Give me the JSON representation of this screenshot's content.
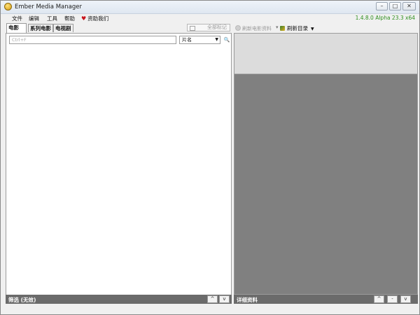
{
  "window": {
    "title": "Ember Media Manager",
    "controls": {
      "minimize": "–",
      "maximize": "□",
      "close": "✕"
    }
  },
  "menu": {
    "items": [
      "文件",
      "编辑",
      "工具",
      "帮助"
    ],
    "donate": {
      "icon": "heart-icon",
      "label": "资助我们"
    },
    "version": "1.4.8.0 Alpha 23.3 x64"
  },
  "tabs": [
    "电影",
    "系列电影",
    "电视剧"
  ],
  "toolbar": {
    "mark_all": "全部标记",
    "refresh_data": "刷新电影资料",
    "refresh_dirs": "刷新目录"
  },
  "filter": {
    "search_placeholder": "Ctrl+F",
    "sort_value": "片名",
    "search_icon": "magnifier-icon"
  },
  "left_status": {
    "label": "筛选 (无效)",
    "up": "^",
    "down": "v"
  },
  "right_status": {
    "label": "详细资料",
    "up": "^",
    "mid": "-",
    "down": "v"
  },
  "colors": {
    "version_green": "#2f8f1f",
    "status_bar": "#6b6b6b",
    "detail_bg": "#808080",
    "heart_red": "#c8141c"
  }
}
